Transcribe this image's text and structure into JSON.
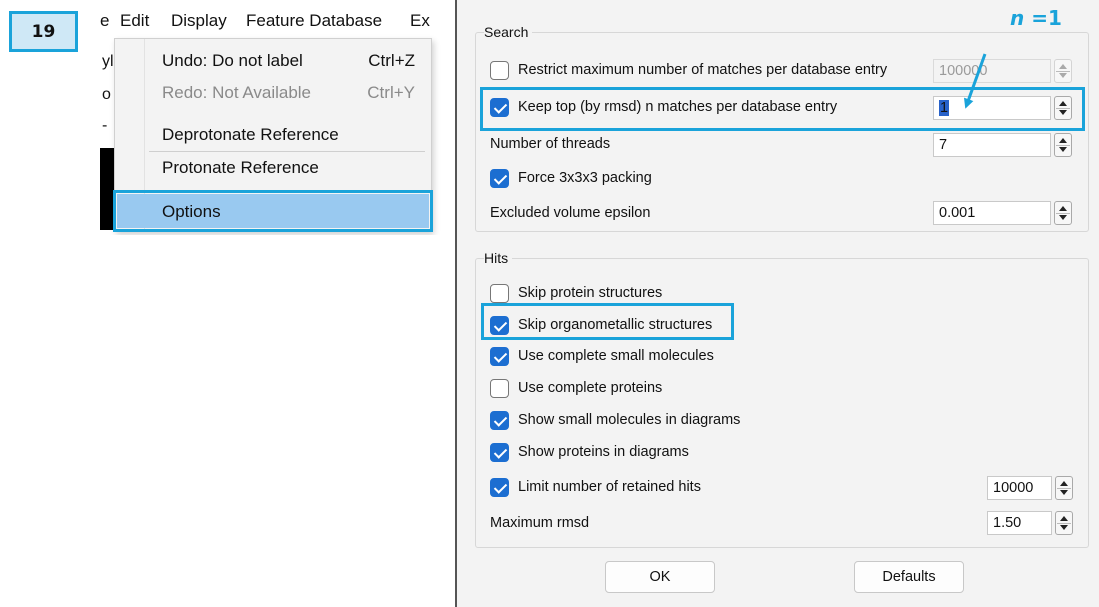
{
  "step": {
    "number": "19"
  },
  "menubar": {
    "items": [
      "e",
      "Edit",
      "Display",
      "Feature Database",
      "Ex"
    ]
  },
  "left_fragments": [
    "yl",
    "o",
    "-"
  ],
  "edit_menu": {
    "items": [
      {
        "label": "Undo: Do not label",
        "shortcut": "Ctrl+Z",
        "enabled": true
      },
      {
        "label": "Redo: Not Available",
        "shortcut": "Ctrl+Y",
        "enabled": false
      },
      {
        "label": "Deprotonate Reference",
        "shortcut": "",
        "enabled": true
      },
      {
        "label": "Protonate Reference",
        "shortcut": "",
        "enabled": true
      },
      {
        "label": "Options",
        "shortcut": "",
        "enabled": true,
        "selected": true
      }
    ]
  },
  "annotation": {
    "n_symbol": "n",
    "n_value": "=1"
  },
  "search": {
    "title": "Search",
    "restrict": {
      "label": "Restrict maximum number of matches per database entry",
      "checked": false,
      "value": "100000",
      "enabled": false
    },
    "keep_top": {
      "label": "Keep top (by rmsd) n matches per database entry",
      "checked": true,
      "value": "1"
    },
    "threads": {
      "label": "Number of threads",
      "value": "7"
    },
    "force_packing": {
      "label": "Force 3x3x3 packing",
      "checked": true
    },
    "epsilon": {
      "label": "Excluded volume epsilon",
      "value": "0.001"
    }
  },
  "hits": {
    "title": "Hits",
    "items": [
      {
        "label": "Skip protein structures",
        "checked": false
      },
      {
        "label": "Skip organometallic structures",
        "checked": true
      },
      {
        "label": "Use complete small molecules",
        "checked": true
      },
      {
        "label": "Use complete proteins",
        "checked": false
      },
      {
        "label": "Show small molecules in diagrams",
        "checked": true
      },
      {
        "label": "Show proteins in diagrams",
        "checked": true
      },
      {
        "label": "Limit number of retained hits",
        "checked": true,
        "value": "10000"
      }
    ],
    "max_rmsd": {
      "label": "Maximum rmsd",
      "value": "1.50"
    }
  },
  "buttons": {
    "ok": "OK",
    "defaults": "Defaults"
  },
  "colors": {
    "highlight": "#1aa3da",
    "checkbox": "#1c6ed1",
    "menu_selected": "#99c9f0"
  }
}
